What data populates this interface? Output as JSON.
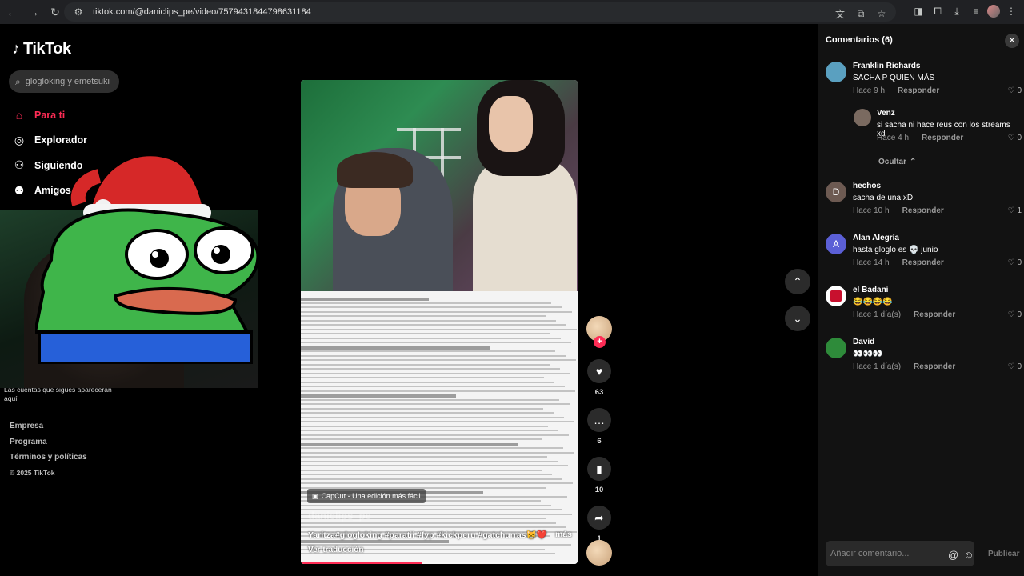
{
  "browser": {
    "url": "tiktok.com/@daniclips_pe/video/7579431844798631184"
  },
  "sidebar": {
    "logo": "TikTok",
    "search_placeholder": "glogloking y emetsuki",
    "menu": [
      {
        "label": "Para ti",
        "icon": "home-icon",
        "active": true
      },
      {
        "label": "Explorador",
        "icon": "compass-icon",
        "active": false
      },
      {
        "label": "Siguiendo",
        "icon": "following-icon",
        "active": false
      },
      {
        "label": "Amigos",
        "icon": "friends-icon",
        "active": false
      }
    ],
    "follow_note": "Las cuentas que sigues aparecerán aquí",
    "footer": [
      "Empresa",
      "Programa",
      "Términos y políticas"
    ],
    "copyright": "© 2025 TikTok"
  },
  "video": {
    "capcut_label": "CapCut - Una edición más fácil",
    "author": "daniclips_pe",
    "caption": "Yaritza#glogloking #paratii #fyp #kickperu #gatchurras😸❤️ ...",
    "more": "más",
    "translate": "Ver traducción",
    "progress": 0.44
  },
  "actions": {
    "likes": "63",
    "comments": "6",
    "saves": "10",
    "shares": "1"
  },
  "comments_panel": {
    "title": "Comentarios (6)",
    "hide_label": "Ocultar",
    "reply_label": "Responder",
    "input_placeholder": "Añadir comentario...",
    "publish_label": "Publicar",
    "comments": [
      {
        "name": "Franklin Richards",
        "text": "SACHA P QUIEN MÁS",
        "time": "Hace 9 h",
        "likes": "0",
        "avatar_color": "#5aa0c0",
        "initial": ""
      },
      {
        "name": "Venz",
        "text": "si sacha ni hace reus con los streams xd",
        "time": "Hace 4 h",
        "likes": "0",
        "avatar_color": "#7a6a60",
        "initial": ""
      },
      {
        "name": "hechos",
        "text": "sacha de una xD",
        "time": "Hace 10 h",
        "likes": "1",
        "avatar_color": "#6d5a52",
        "initial": "D"
      },
      {
        "name": "Alan Alegría",
        "text": "hasta gloglo es 💀 junio",
        "time": "Hace 14 h",
        "likes": "0",
        "avatar_color": "#5b5fd6",
        "initial": "A"
      },
      {
        "name": "el Badani",
        "text": "😂😂😂😂",
        "time": "Hace 1 día(s)",
        "likes": "0",
        "avatar_color": "#ffffff",
        "initial": ""
      },
      {
        "name": "David",
        "text": "👀👀👀",
        "time": "Hace 1 día(s)",
        "likes": "0",
        "avatar_color": "#2e8b3a",
        "initial": ""
      }
    ]
  },
  "colors": {
    "accent": "#fe2c55",
    "panel_bg": "#121212"
  }
}
